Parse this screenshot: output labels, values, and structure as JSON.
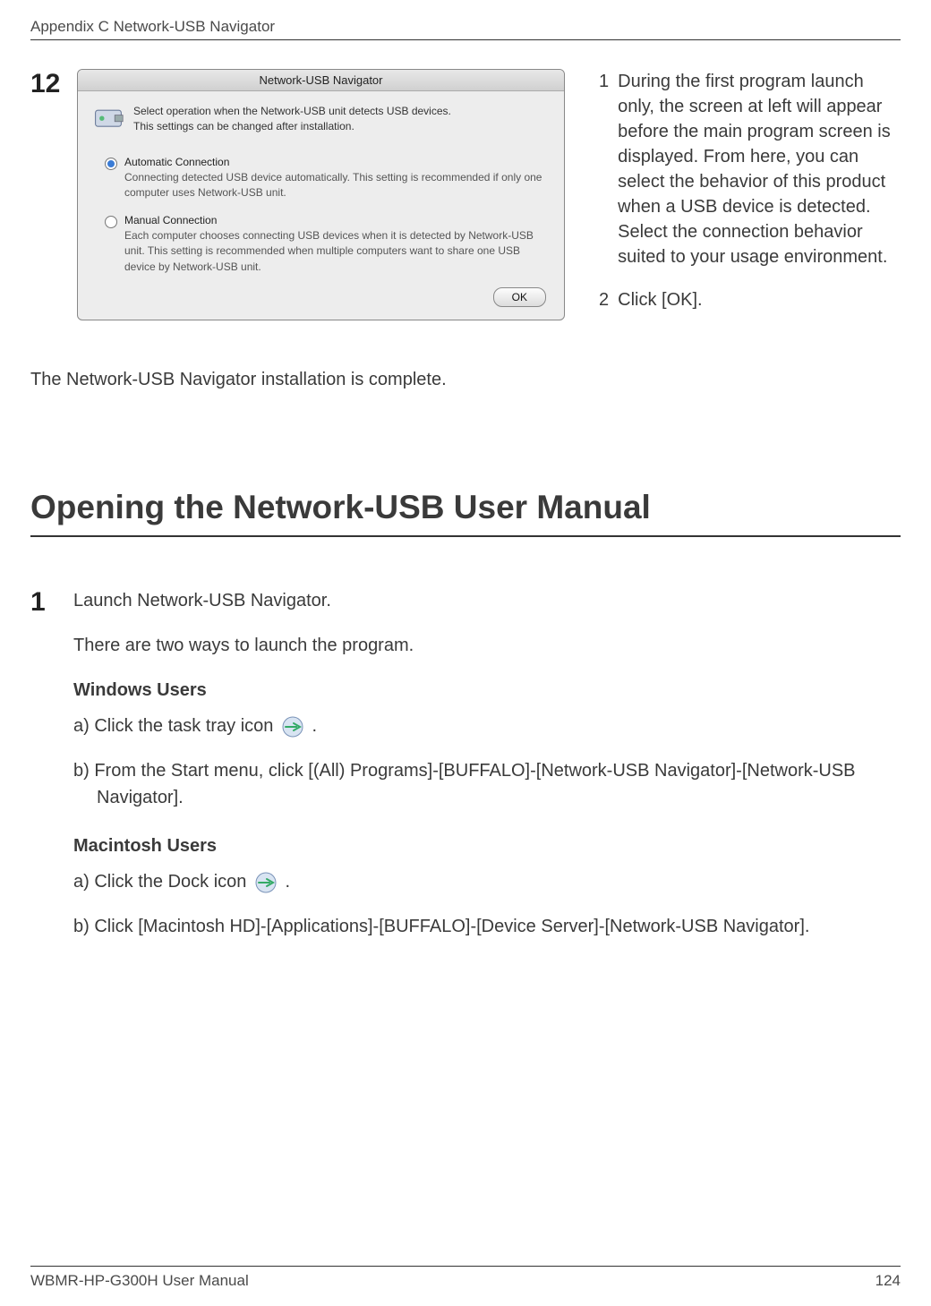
{
  "header": {
    "appendix": "Appendix C  Network-USB Navigator"
  },
  "step12": {
    "number": "12",
    "dialog": {
      "title": "Network-USB Navigator",
      "intro": "Select operation when the Network-USB unit detects USB devices.\nThis settings can be changed after installation.",
      "option1_title": "Automatic Connection",
      "option1_desc": "Connecting detected USB device automatically. This setting is recommended if only one computer uses Network-USB unit.",
      "option2_title": "Manual Connection",
      "option2_desc": "Each computer chooses connecting USB devices when it is detected by Network-USB unit. This setting is recommended when multiple computers want to share one USB device by Network-USB unit.",
      "ok_label": "OK"
    },
    "notes": {
      "n1_num": "1",
      "n1_text": "During the ﬁrst program launch only, the screen at left will appear before the main program screen is displayed. From here, you can select the behavior of this product when a USB device is detected. Select the connection behavior suited to your usage environment.",
      "n2_num": "2",
      "n2_text": "Click [OK]."
    }
  },
  "complete_text": "The Network-USB Navigator installation is complete.",
  "section_heading": "Opening the Network-USB User Manual",
  "step1": {
    "num": "1",
    "line1": "Launch Network-USB Navigator.",
    "line2": "There are two ways to launch the program.",
    "win_heading": "Windows Users",
    "win_a_pre": "a) Click the task tray icon ",
    "win_a_post": " .",
    "win_b": "b) From the Start menu, click [(All) Programs]-[BUFFALO]-[Network-USB Navigator]-[Network-USB Navigator].",
    "mac_heading": "Macintosh Users",
    "mac_a_pre": "a) Click the Dock icon ",
    "mac_a_post": " .",
    "mac_b": "b) Click [Macintosh HD]-[Applications]-[BUFFALO]-[Device Server]-[Network-USB Navigator]."
  },
  "footer": {
    "left": "WBMR-HP-G300H User Manual",
    "right": "124"
  }
}
